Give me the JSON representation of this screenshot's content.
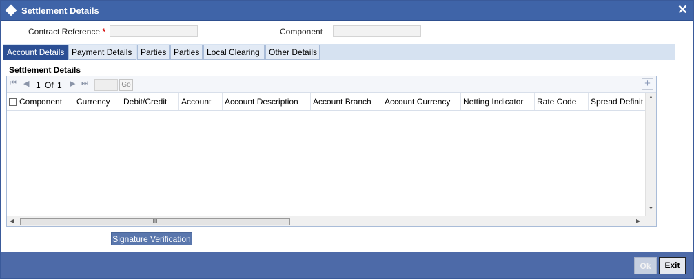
{
  "window": {
    "title": "Settlement Details",
    "close_symbol": "✕"
  },
  "form": {
    "contract_reference_label": "Contract Reference",
    "required_marker": "*",
    "contract_reference_value": "",
    "component_label": "Component",
    "component_value": ""
  },
  "tabs": [
    {
      "label": "Account Details",
      "active": true
    },
    {
      "label": "Payment Details",
      "active": false
    },
    {
      "label": "Parties",
      "active": false
    },
    {
      "label": "Parties",
      "active": false
    },
    {
      "label": "Local Clearing",
      "active": false
    },
    {
      "label": "Other Details",
      "active": false
    }
  ],
  "section": {
    "title": "Settlement Details"
  },
  "pager": {
    "first_symbol": "⏮",
    "prev_symbol": "◀",
    "current": "1",
    "of_label": "Of",
    "total": "1",
    "next_symbol": "▶",
    "last_symbol": "⏭",
    "go_label": "Go",
    "add_symbol": "+"
  },
  "grid": {
    "columns": [
      "Component",
      "Currency",
      "Debit/Credit",
      "Account",
      "Account Description",
      "Account Branch",
      "Account Currency",
      "Netting Indicator",
      "Rate Code",
      "Spread Definit"
    ],
    "rows": [],
    "hscroll_grip": "III"
  },
  "buttons": {
    "signature_verification": "Signature Verification",
    "ok": "Ok",
    "exit": "Exit"
  },
  "colors": {
    "titlebar": "#3f64a8",
    "active_tab": "#2c4f94",
    "footer": "#4d6aa8"
  }
}
